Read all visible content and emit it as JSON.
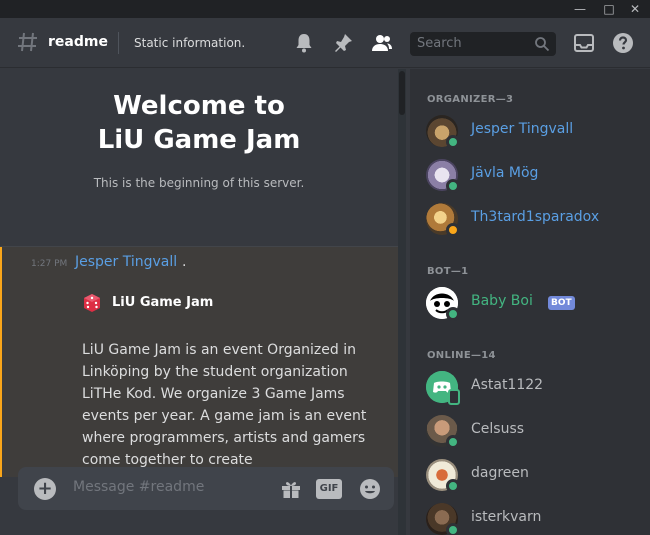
{
  "window": {
    "controls": [
      "—",
      "□",
      "✕"
    ]
  },
  "header": {
    "channel": "readme",
    "topic": "Static information.",
    "search_placeholder": "Search"
  },
  "welcome": {
    "title_line1": "Welcome to",
    "title_line2": "LiU Game Jam",
    "subtitle": "This is the beginning of this server."
  },
  "message": {
    "time": "1:27 PM",
    "author": "Jesper Tingvall",
    "dot": ".",
    "embed_title": "LiU Game Jam",
    "body": "LiU Game Jam is an event Organized in Linköping by the student organization LiTHe Kod. We organize 3 Game Jams events per year. A game jam is an event where programmers, artists and gamers come together to create"
  },
  "composer": {
    "placeholder": "Message #readme",
    "gif_label": "GIF"
  },
  "members": {
    "organizer_header": "ORGANIZER—3",
    "bot_header": "BOT—1",
    "online_header": "ONLINE—14",
    "organizers": [
      {
        "name": "Jesper Tingvall",
        "status": "online"
      },
      {
        "name": "Jävla Mög",
        "status": "online"
      },
      {
        "name": "Th3tard1sparadox",
        "status": "idle"
      }
    ],
    "bots": [
      {
        "name": "Baby Boi",
        "badge": "BOT",
        "status": "online"
      }
    ],
    "online": [
      {
        "name": "Astat1122",
        "status": "mobile"
      },
      {
        "name": "Celsuss",
        "status": "online"
      },
      {
        "name": "dagreen",
        "status": "online"
      },
      {
        "name": "isterkvarn",
        "status": "online"
      }
    ]
  },
  "colors": {
    "organizer": "#5a9fe4",
    "bot": "#43b581",
    "member": "#b9bbbe",
    "online": "#43b581",
    "idle": "#faa61a",
    "accent": "#7289da"
  }
}
